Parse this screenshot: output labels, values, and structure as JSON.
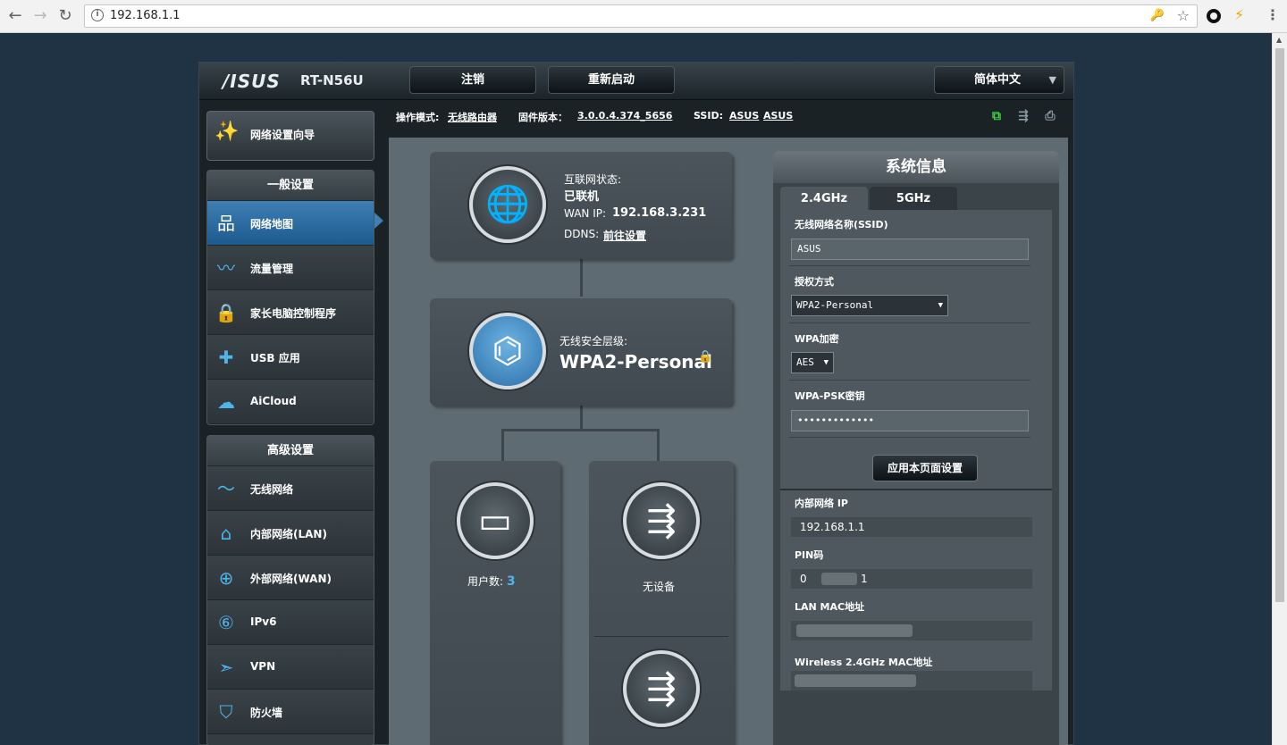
{
  "browser": {
    "url": "192.168.1.1",
    "back_icon": "←",
    "forward_icon": "→",
    "reload_icon": "↻",
    "info_icon": "i",
    "key_icon": "🔑",
    "star_icon": "☆",
    "menu_icon": "⋮",
    "ext2_icon": "⚡"
  },
  "header": {
    "logo": "/ISUS",
    "model": "RT-N56U",
    "logout_label": "注销",
    "reboot_label": "重新启动",
    "language": "简体中文",
    "caret": "▼"
  },
  "status": {
    "mode_label": "操作模式:",
    "mode_value": "无线路由器",
    "firmware_label": "固件版本：",
    "firmware_value": "3.0.0.4.374_5656",
    "ssid_label": "SSID:",
    "ssid_values": [
      "ASUS",
      "ASUS"
    ]
  },
  "sidebar": {
    "wizard_label": "网络设置向导",
    "wizard_icon": "✨",
    "general_head": "一般设置",
    "general_items": [
      {
        "label": "网络地图",
        "icon": "品"
      },
      {
        "label": "流量管理",
        "icon": "〰"
      },
      {
        "label": "家长电脑控制程序",
        "icon": "🔒"
      },
      {
        "label": "USB 应用",
        "icon": "✚"
      },
      {
        "label": "AiCloud",
        "icon": "☁"
      }
    ],
    "advanced_head": "高级设置",
    "advanced_items": [
      {
        "label": "无线网络",
        "icon": "〜"
      },
      {
        "label": "内部网络(LAN)",
        "icon": "⌂"
      },
      {
        "label": "外部网络(WAN)",
        "icon": "⊕"
      },
      {
        "label": "IPv6",
        "icon": "⑥"
      },
      {
        "label": "VPN",
        "icon": "➣"
      },
      {
        "label": "防火墙",
        "icon": "⛉"
      }
    ]
  },
  "map": {
    "internet": {
      "status_label": "互联网状态:",
      "status_value": "已联机",
      "wan_ip_label": "WAN IP:",
      "wan_ip": "192.168.3.231",
      "ddns_label": "DDNS:",
      "ddns_link": "前往设置",
      "icon": "🌐"
    },
    "security": {
      "label": "无线安全层级:",
      "value": "WPA2-Personal",
      "lock_icon": "🔒",
      "icon": "⌬"
    },
    "clients": {
      "label": "用户数:",
      "count": "3",
      "icon": "▭"
    },
    "usb1": {
      "label": "无设备",
      "icon": "⇶"
    },
    "usb2": {
      "icon": "⇶"
    }
  },
  "sysinfo": {
    "title": "系统信息",
    "tabs": [
      "2.4GHz",
      "5GHz"
    ],
    "ssid_label": "无线网络名称(SSID)",
    "ssid_value": "ASUS",
    "auth_label": "授权方式",
    "auth_value": "WPA2-Personal",
    "enc_label": "WPA加密",
    "enc_value": "AES",
    "psk_label": "WPA-PSK密钥",
    "psk_value": "•••••••••••••",
    "apply_label": "应用本页面设置",
    "lan_ip_label": "内部网络 IP",
    "lan_ip_value": "192.168.1.1",
    "pin_label": "PIN码",
    "pin_value_start": "0",
    "pin_value_end": "1",
    "lan_mac_label": "LAN MAC地址",
    "wl_mac_label": "Wireless 2.4GHz MAC地址",
    "select_arrow": "▼"
  },
  "colors": {
    "accent": "#4fb4ea",
    "active_menu": "#2b6fa6",
    "background": "#1f3345"
  }
}
